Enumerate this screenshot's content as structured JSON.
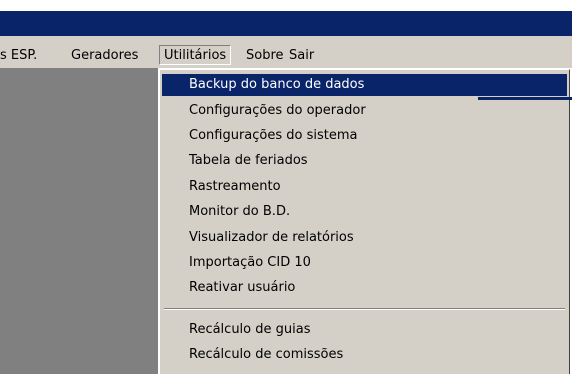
{
  "menubar": {
    "items": [
      {
        "label": "s ESP."
      },
      {
        "label": "Geradores"
      },
      {
        "label": "Utilitários"
      },
      {
        "label": "Sobre"
      },
      {
        "label": "Sair"
      }
    ]
  },
  "dropdown": {
    "items": [
      {
        "label": "Backup do banco de dados"
      },
      {
        "label": "Configurações do operador"
      },
      {
        "label": "Configurações do sistema"
      },
      {
        "label": "Tabela de feriados"
      },
      {
        "label": "Rastreamento"
      },
      {
        "label": "Monitor do B.D."
      },
      {
        "label": "Visualizador de relatórios"
      },
      {
        "label": "Importação CID 10"
      },
      {
        "label": "Reativar usuário"
      },
      {
        "label": "Recálculo de guias"
      },
      {
        "label": "Recálculo de comissões"
      }
    ],
    "selected_index": 0
  },
  "colors": {
    "title_bar": "#0a246a",
    "menu_bg": "#d4d0c8",
    "workspace": "#808080",
    "highlight": "#0a246a"
  }
}
